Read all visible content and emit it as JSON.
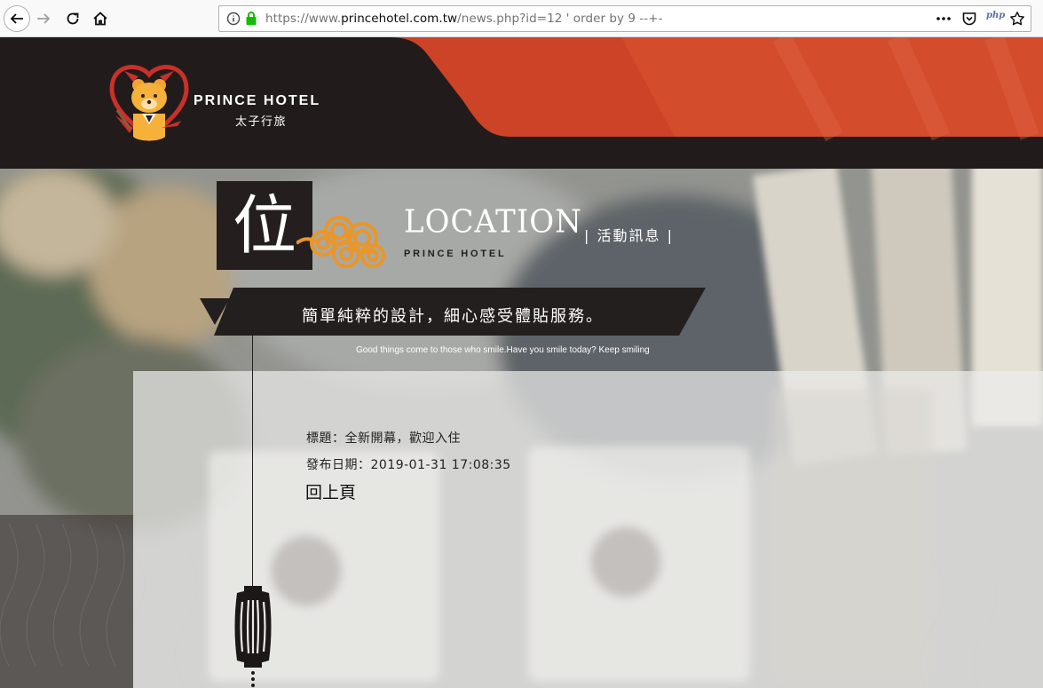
{
  "browser": {
    "url_scheme": "https://www.",
    "url_domain": "princehotel.com.tw",
    "url_path": "/news.php?id=12 ' order by 9 --+-",
    "php_badge": "php"
  },
  "header": {
    "brand_en": "PRINCE HOTEL",
    "brand_zh": "太子行旅",
    "accent_color": "#d2462a",
    "bg_color": "#211c1b"
  },
  "hero": {
    "big_char": "位",
    "location_title": "LOCATION",
    "location_sub": "PRINCE HOTEL",
    "section_tag": "| 活動訊息 |",
    "slogan": "簡單純粹的設計，細心感受體貼服務。",
    "slogan_en": "Good things come to those who smile.Have you smile today? Keep smiling"
  },
  "news": {
    "title_line": "標題：全新開幕，歡迎入住",
    "date_line": "發布日期：2019-01-31 17:08:35",
    "back_label": "回上頁"
  }
}
